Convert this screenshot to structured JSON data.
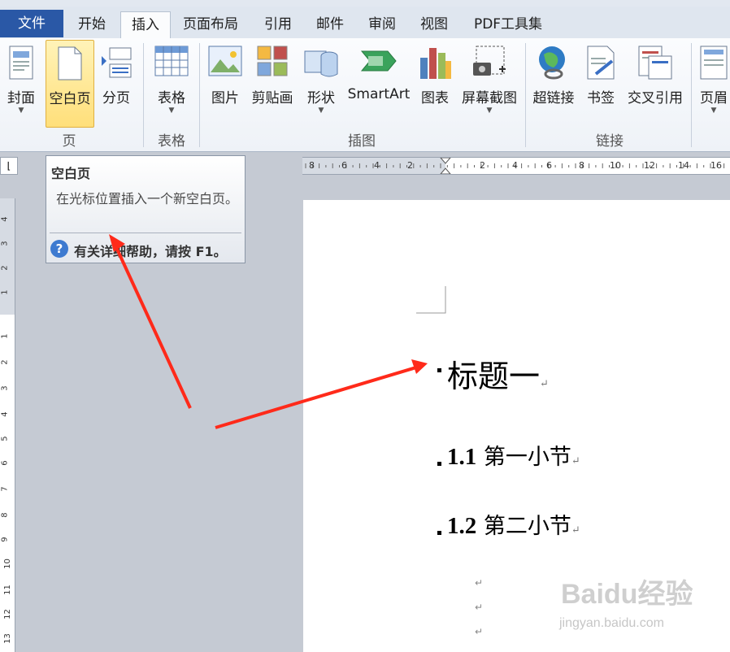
{
  "tabs": [
    {
      "label": "文件"
    },
    {
      "label": "开始"
    },
    {
      "label": "插入"
    },
    {
      "label": "页面布局"
    },
    {
      "label": "引用"
    },
    {
      "label": "邮件"
    },
    {
      "label": "审阅"
    },
    {
      "label": "视图"
    },
    {
      "label": "PDF工具集"
    }
  ],
  "ribbon": {
    "buttons": {
      "cover": "封面",
      "blank_page": "空白页",
      "page_break": "分页",
      "table": "表格",
      "picture": "图片",
      "clipart": "剪贴画",
      "shapes": "形状",
      "smartart": "SmartArt",
      "chart": "图表",
      "screenshot": "屏幕截图",
      "hyperlink": "超链接",
      "bookmark": "书签",
      "cross_ref": "交叉引用",
      "header": "页眉"
    },
    "groups": {
      "pages": "页",
      "tables": "表格",
      "illustrations": "插图",
      "links": "链接"
    }
  },
  "tooltip": {
    "title": "空白页",
    "description": "在光标位置插入一个新空白页。",
    "help": "有关详细帮助，请按 F1。"
  },
  "ruler": {
    "h_labels": [
      "8",
      "6",
      "4",
      "2",
      "2",
      "4",
      "6",
      "8",
      "10",
      "12",
      "14",
      "16"
    ],
    "v_labels": [
      "4",
      "3",
      "2",
      "1",
      "1",
      "2",
      "3",
      "4",
      "5",
      "6",
      "7",
      "8",
      "9",
      "10",
      "11",
      "12",
      "13"
    ]
  },
  "document": {
    "heading1": "标题一",
    "h2_1_num": "1.1",
    "h2_1_text": "第一小节",
    "h2_2_num": "1.2",
    "h2_2_text": "第二小节",
    "para_mark": "↵"
  },
  "watermark": {
    "logo": "Baidu经验",
    "url": "jingyan.baidu.com"
  },
  "colors": {
    "file_tab": "#2a58a6",
    "selected_button": "#ffdf7a",
    "arrow": "#ff2a1a"
  }
}
